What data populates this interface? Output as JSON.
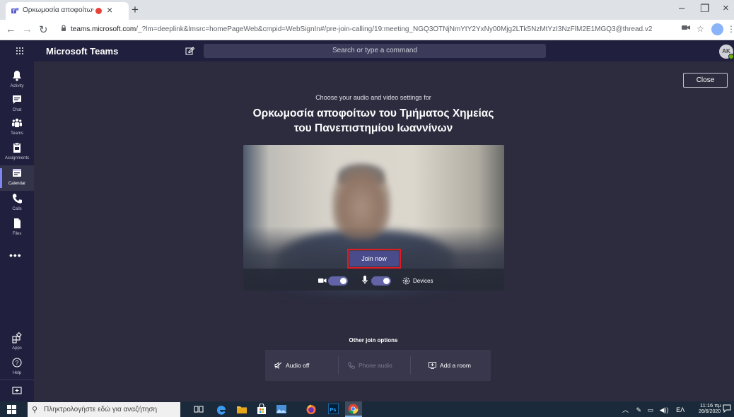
{
  "browser": {
    "tab_title": "Ορκωμοσία αποφοίτων του",
    "tab_close": "×",
    "new_tab": "+",
    "url_host": "teams.microsoft.com",
    "url_path": "/_?lm=deeplink&lmsrc=homePageWeb&cmpid=WebSignIn#/pre-join-calling/19:meeting_NGQ3OTNjNmYtY2YxNy00Mjg2LTk5NzMtYzI3NzFlM2E1MGQ3@thread.v2",
    "window_controls": {
      "minimize": "–",
      "maximize": "❐",
      "close": "×"
    }
  },
  "teams": {
    "app_title": "Microsoft Teams",
    "search_placeholder": "Search or type a command",
    "avatar_initials": "AK",
    "rail": [
      {
        "label": "Activity",
        "icon": "bell-icon"
      },
      {
        "label": "Chat",
        "icon": "chat-icon"
      },
      {
        "label": "Teams",
        "icon": "teams-icon"
      },
      {
        "label": "Assignments",
        "icon": "assignments-icon"
      },
      {
        "label": "Calendar",
        "icon": "calendar-icon",
        "active": true
      },
      {
        "label": "Calls",
        "icon": "phone-icon"
      },
      {
        "label": "Files",
        "icon": "files-icon"
      }
    ],
    "rail_more": "•••",
    "rail_bottom": [
      {
        "label": "Apps",
        "icon": "apps-icon"
      },
      {
        "label": "Help",
        "icon": "help-icon"
      }
    ]
  },
  "prejoin": {
    "close_label": "Close",
    "choose_text": "Choose your audio and video settings for",
    "meeting_title_line1": "Ορκωμοσία αποφοίτων του Τμήματος Χημείας",
    "meeting_title_line2": "του Πανεπιστημίου Ιωαννίνων",
    "join_label": "Join now",
    "camera_on": true,
    "mic_on": true,
    "devices_label": "Devices",
    "other_options_title": "Other join options",
    "options": [
      {
        "label": "Audio off",
        "icon": "speaker-off-icon",
        "enabled": true
      },
      {
        "label": "Phone audio",
        "icon": "phone-icon",
        "enabled": false
      },
      {
        "label": "Add a room",
        "icon": "cast-icon",
        "enabled": true
      }
    ]
  },
  "taskbar": {
    "search_placeholder": "Πληκτρολογήστε εδώ για αναζήτηση",
    "tray_language": "ΕΛ",
    "clock_time": "11:16 πμ",
    "clock_date": "26/6/2020"
  },
  "colors": {
    "teams_dark": "#201f3d",
    "main_bg": "#2d2c3f",
    "accent": "#6264a7",
    "join_button": "#494b8b",
    "highlight_frame": "#e21a22"
  }
}
